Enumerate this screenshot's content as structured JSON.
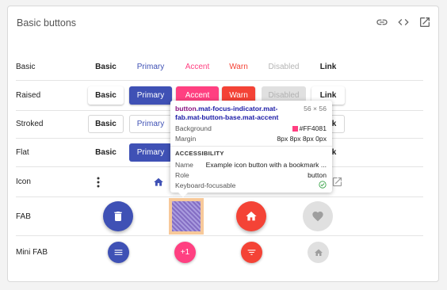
{
  "card": {
    "title": "Basic buttons",
    "header_icons": [
      "link-icon",
      "code-icon",
      "open-in-new-icon"
    ]
  },
  "rows": {
    "basic": "Basic",
    "raised": "Raised",
    "stroked": "Stroked",
    "flat": "Flat",
    "icon": "Icon",
    "fab": "FAB",
    "mini_fab": "Mini FAB"
  },
  "buttons": {
    "basic": "Basic",
    "primary": "Primary",
    "accent": "Accent",
    "warn": "Warn",
    "disabled": "Disabled",
    "link": "Link"
  },
  "colors": {
    "primary": "#3f51b5",
    "accent": "#ff4081",
    "warn": "#f44336",
    "disabled": "#e0e0e0"
  },
  "mini_fab": {
    "accent_label": "+1"
  },
  "tooltip": {
    "selector_tag": "button",
    "selector_classes": ".mat-focus-indicator.mat-fab.mat-button-base.mat-accent",
    "size": "56 × 56",
    "background_label": "Background",
    "background_value": "#FF4081",
    "margin_label": "Margin",
    "margin_value": "8px 8px 8px 0px",
    "section": "ACCESSIBILITY",
    "name_label": "Name",
    "name_value": "Example icon button with a bookmark ...",
    "role_label": "Role",
    "role_value": "button",
    "focusable_label": "Keyboard-focusable"
  }
}
